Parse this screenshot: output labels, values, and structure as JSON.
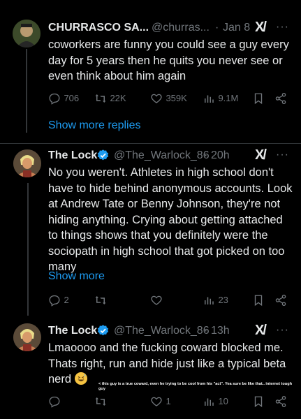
{
  "tweets": [
    {
      "name": "CHURRASCO SA...",
      "handle": "@churras...",
      "separator": "·",
      "time": "Jan 8",
      "text": "coworkers are funny you could see a guy every day for 5 years then he quits you never see or even think about him again",
      "stats": {
        "replies": "706",
        "reposts": "22K",
        "likes": "359K",
        "views": "9.1M"
      }
    },
    {
      "name": "The Lock",
      "handle": "@The_Warlock_86",
      "separator": "·",
      "time": "20h",
      "text": "No you weren't. Athletes in high school don't have to hide behind anonymous accounts. Look at Andrew Tate or Benny Johnson, they're not hiding anything. Crying about getting attached to things shows that you definitely were the sociopath in high school that got picked on too many",
      "show_more": "Show more",
      "stats": {
        "replies": "2",
        "views": "23"
      }
    },
    {
      "name": "The Lock",
      "handle": "@The_Warlock_86",
      "separator": "·",
      "time": "13h",
      "text": "Lmaoooo and the fucking coward blocked me. Thats right, run and hide just like a typical beta nerd",
      "stats": {
        "likes": "1",
        "views": "10"
      }
    }
  ],
  "show_more_replies": "Show more replies",
  "annotation": "< this guy is a true coward, even he trying to be cool from his \"act\". Yea sure be like that.. internet tough guy",
  "colors": {
    "background": "#000000",
    "accent": "#1d9bf0",
    "muted": "#71767b",
    "verified": "#1d9bf0"
  }
}
